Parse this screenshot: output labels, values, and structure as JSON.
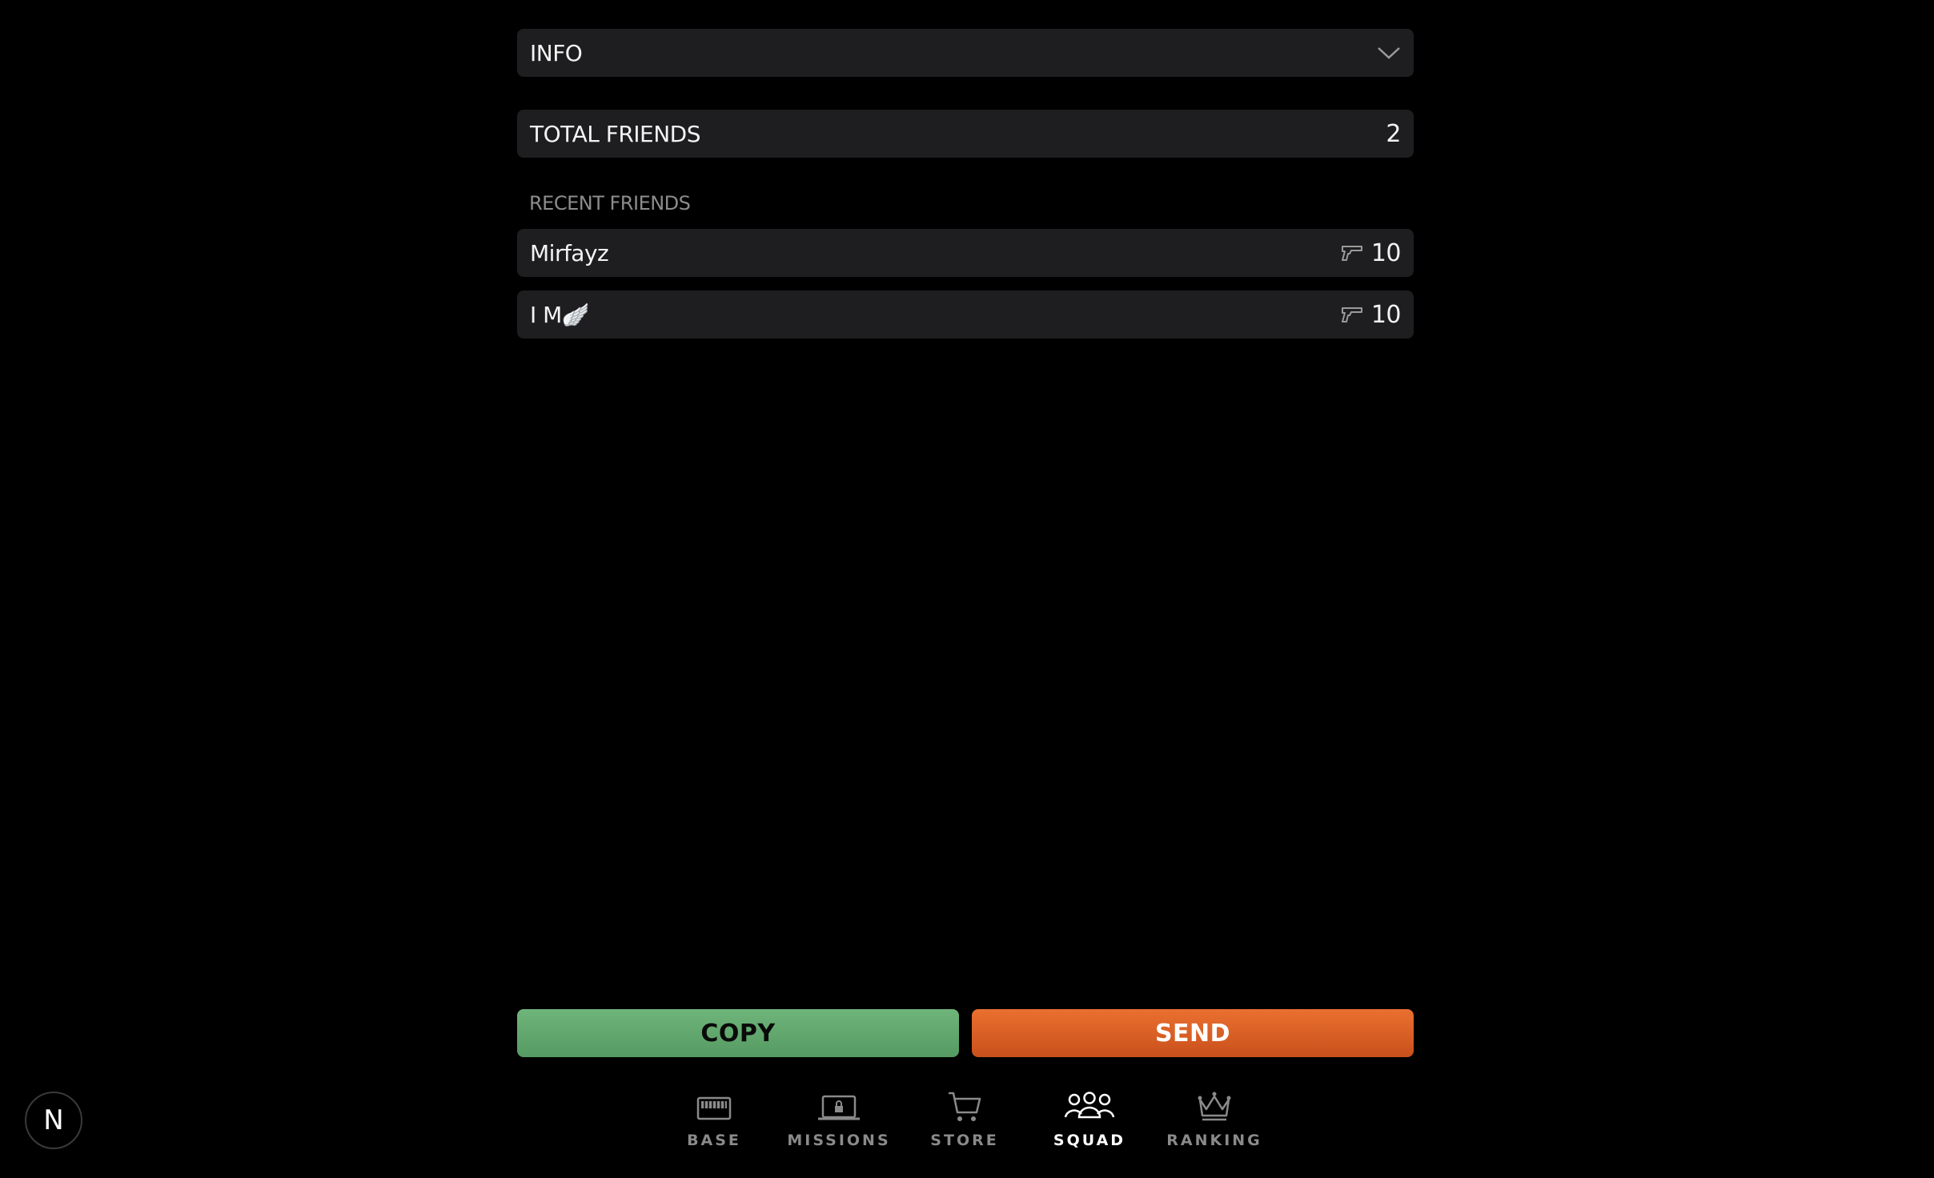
{
  "info": {
    "label": "INFO",
    "icon": "chevron-down-icon"
  },
  "total_friends": {
    "label": "TOTAL FRIENDS",
    "value": "2"
  },
  "recent": {
    "title": "RECENT FRIENDS",
    "friends": [
      {
        "name": "Mirfayz",
        "count": "10",
        "icon": "pistol-icon"
      },
      {
        "name": "I M🪽",
        "count": "10",
        "icon": "pistol-icon"
      }
    ]
  },
  "actions": {
    "copy_label": "COPY",
    "send_label": "SEND"
  },
  "nav": {
    "items": [
      {
        "label": "BASE",
        "icon": "base-icon",
        "active": false
      },
      {
        "label": "MISSIONS",
        "icon": "laptop-lock-icon",
        "active": false
      },
      {
        "label": "STORE",
        "icon": "cart-icon",
        "active": false
      },
      {
        "label": "SQUAD",
        "icon": "squad-icon",
        "active": true
      },
      {
        "label": "RANKING",
        "icon": "crown-icon",
        "active": false
      }
    ]
  },
  "badge": {
    "letter": "N"
  },
  "colors": {
    "background": "#000000",
    "row": "#1e1e20",
    "copy": "#62a86e",
    "send": "#e0602a",
    "nav_inactive": "#8a8a8a",
    "nav_active": "#ffffff"
  }
}
